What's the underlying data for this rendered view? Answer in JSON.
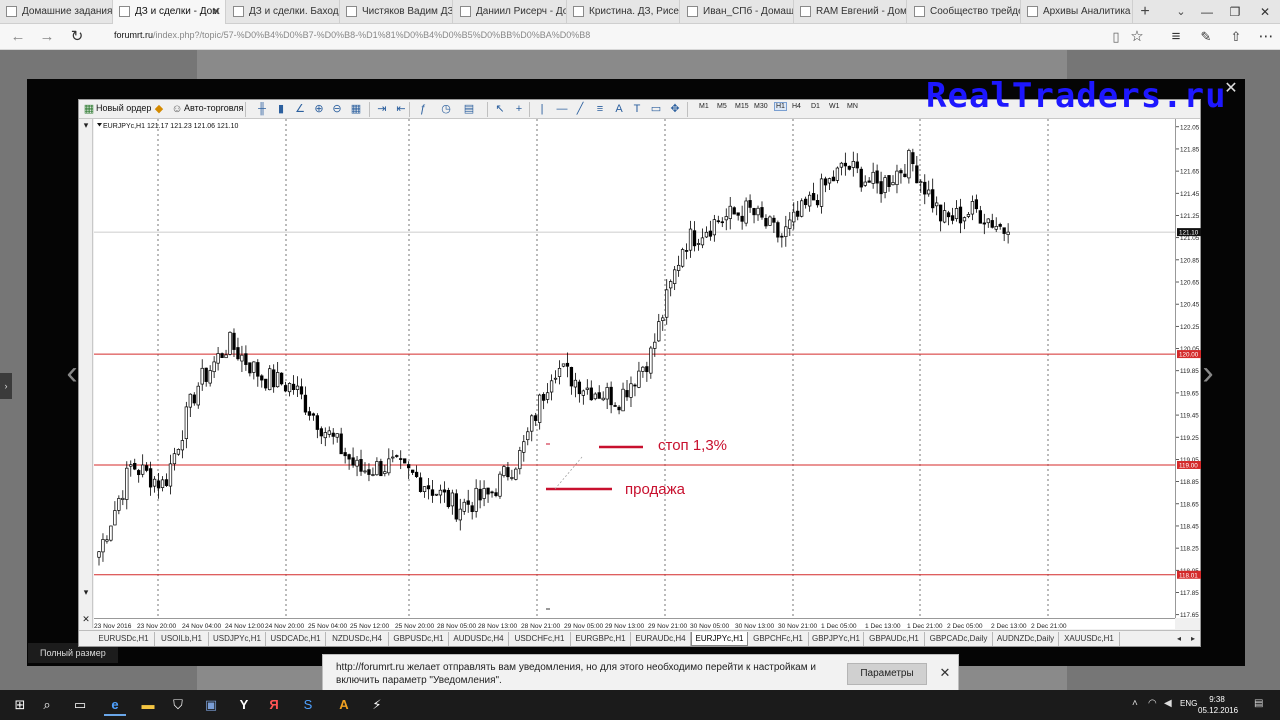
{
  "browser": {
    "tabs": [
      {
        "label": "Домашние задания и",
        "active": false
      },
      {
        "label": "ДЗ и сделки - Дом",
        "active": true
      },
      {
        "label": "ДЗ и сделки. Баходир",
        "active": false
      },
      {
        "label": "Чистяков Вадим ДЗ -",
        "active": false
      },
      {
        "label": "Даниил Рисерч - Дом",
        "active": false
      },
      {
        "label": "Кристина. ДЗ, Рисерч",
        "active": false
      },
      {
        "label": "Иван_СПб - Домашни",
        "active": false
      },
      {
        "label": "RAM Евгений - Дома",
        "active": false
      },
      {
        "label": "Сообщество трейдер",
        "active": false
      },
      {
        "label": "Архивы Аналитика - F",
        "active": false
      }
    ],
    "tab_close_glyph": "✕",
    "new_tab_glyph": "+",
    "address_host": "forumrt.ru",
    "address_path": "/index.php?/topic/57-%D0%B4%D0%B7-%D0%B8-%D1%81%D0%B4%D0%B5%D0%BB%D0%BA%D0%B8"
  },
  "lightbox": {
    "watermark": "RealTraders.ru",
    "full_size_label": "Полный размер",
    "close_glyph": "✕",
    "prev_glyph": "‹",
    "next_glyph": "›"
  },
  "mt4": {
    "toolbar": {
      "new_order_label": "Новый ордер",
      "autotrading_label": "Авто-торговля",
      "timeframes": [
        "M1",
        "M5",
        "M15",
        "M30",
        "H1",
        "H4",
        "D1",
        "W1",
        "MN"
      ],
      "active_timeframe": "H1"
    },
    "chart_header": "EURJPYc,H1  121.17 121.23 121.06 121.10",
    "symbol_tabs": [
      "EURUSDc,H1",
      "USOILb,H1",
      "USDJPYc,H1",
      "USDCADc,H1",
      "NZDUSDc,H4",
      "GBPUSDc,H1",
      "AUDUSDc,H4",
      "USDCHFc,H1",
      "EURGBPc,H1",
      "EURAUDc,H4",
      "EURJPYc,H1",
      "GBPCHFc,H1",
      "GBPJPYc,H1",
      "GBPAUDc,H1",
      "GBPCADc,Daily",
      "AUDNZDc,Daily",
      "XAUUSDc,H1"
    ],
    "active_symbol_tab": "EURJPYc,H1"
  },
  "chart_data": {
    "type": "candlestick",
    "symbol": "EURJPYc",
    "timeframe": "H1",
    "ohlc_last": {
      "open": 121.17,
      "high": 121.23,
      "low": 121.06,
      "close": 121.1
    },
    "y_ticks": [
      122.05,
      121.85,
      121.65,
      121.45,
      121.25,
      121.05,
      120.85,
      120.65,
      120.45,
      120.25,
      120.05,
      119.85,
      119.65,
      119.45,
      119.25,
      119.05,
      118.85,
      118.65,
      118.45,
      118.25,
      118.05,
      117.85,
      117.65
    ],
    "ylim": [
      117.62,
      122.12
    ],
    "x_ticks": [
      "23 Nov 2016",
      "23 Nov 20:00",
      "24 Nov 04:00",
      "24 Nov 12:00",
      "24 Nov 20:00",
      "25 Nov 04:00",
      "25 Nov 12:00",
      "25 Nov 20:00",
      "28 Nov 05:00",
      "28 Nov 13:00",
      "28 Nov 21:00",
      "29 Nov 05:00",
      "29 Nov 13:00",
      "29 Nov 21:00",
      "30 Nov 05:00",
      "30 Nov 13:00",
      "30 Nov 21:00",
      "1 Dec 05:00",
      "1 Dec 13:00",
      "1 Dec 21:00",
      "2 Dec 05:00",
      "2 Dec 13:00",
      "2 Dec 21:00"
    ],
    "current_price_label": "121.10",
    "horizontal_levels": [
      {
        "price": 120.0,
        "label": "120.00",
        "color": "#d42a2a"
      },
      {
        "price": 119.0,
        "label": "119.00",
        "color": "#d42a2a"
      },
      {
        "price": 118.01,
        "label": "118.01",
        "color": "#d42a2a"
      }
    ],
    "annotations": [
      {
        "text": "стоп 1,3%",
        "color": "#c8102e"
      },
      {
        "text": "продажа",
        "color": "#c8102e"
      }
    ],
    "key_closes": [
      118.22,
      119.0,
      118.82,
      119.7,
      120.1,
      119.8,
      119.7,
      119.3,
      118.95,
      119.0,
      118.85,
      118.62,
      118.72,
      119.1,
      119.9,
      119.7,
      119.6,
      120.0,
      121.0,
      121.2,
      121.3,
      121.05,
      121.4,
      121.7,
      121.5,
      121.75,
      121.2,
      121.3,
      121.1
    ],
    "up_color": "#ffffff",
    "down_color": "#000000"
  },
  "notification": {
    "text": "http://forumrt.ru желает отправлять вам уведомления, но для этого необходимо перейти к настройкам и включить параметр \"Уведомления\".",
    "button_label": "Параметры",
    "close_glyph": "✕"
  },
  "taskbar": {
    "language": "ENG",
    "time": "9:38",
    "date": "05.12.2016"
  },
  "colors": {
    "level_line": "#d42a2a",
    "annotation": "#c8102e",
    "watermark": "#1d17ff"
  }
}
